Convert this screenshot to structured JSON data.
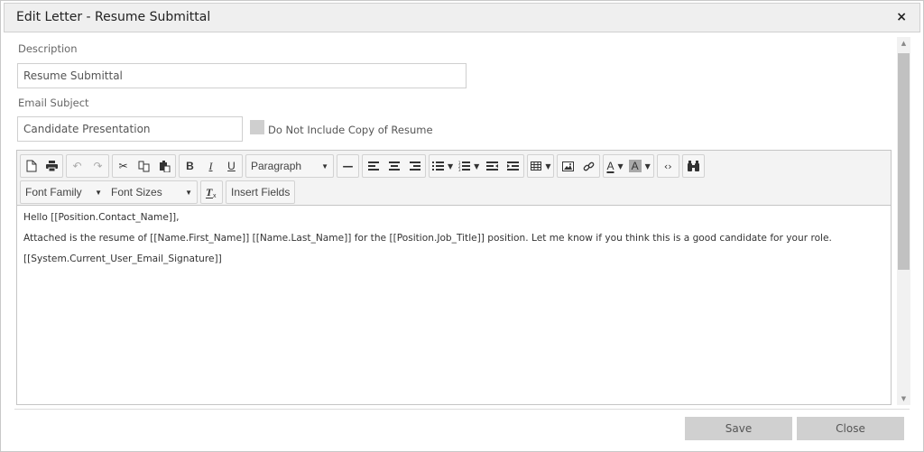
{
  "dialog": {
    "title": "Edit Letter - Resume Submittal",
    "close_icon": "×"
  },
  "form": {
    "description_label": "Description",
    "description_value": "Resume Submittal",
    "subject_label": "Email Subject",
    "subject_value": "Candidate Presentation",
    "no_copy_checkbox_label": "Do Not Include Copy of Resume",
    "no_copy_checked": false
  },
  "toolbar": {
    "row1": {
      "new_document": "🗋",
      "print": "⎙",
      "undo": "↶",
      "redo": "↷",
      "cut": "✂",
      "copy": "⧉",
      "paste": "📋",
      "bold": "B",
      "italic": "I",
      "underline": "U",
      "block_format": "Paragraph",
      "horizontal_rule": "—",
      "align_left": "≡",
      "align_center": "≡",
      "align_right": "≡",
      "bullet_list": "☰",
      "numbered_list": "☰",
      "outdent": "⇤",
      "indent": "⇥",
      "table": "▦",
      "image": "▣",
      "link": "🔗",
      "text_color": "A",
      "background_color": "A",
      "source_code": "‹›",
      "find_replace": "⚲"
    },
    "row2": {
      "font_family": "Font Family",
      "font_sizes": "Font Sizes",
      "clear_formatting": "Tx",
      "insert_fields": "Insert Fields"
    },
    "caret": "▼"
  },
  "editor": {
    "paragraphs": [
      "Hello [[Position.Contact_Name]],",
      "Attached is the resume of [[Name.First_Name]] [[Name.Last_Name]] for the [[Position.Job_Title]] position. Let me know if you think this is a good candidate for your role.",
      "[[System.Current_User_Email_Signature]]"
    ]
  },
  "scrollbar": {
    "up_arrow": "▲",
    "down_arrow": "▼"
  },
  "footer": {
    "save_label": "Save",
    "close_label": "Close"
  }
}
